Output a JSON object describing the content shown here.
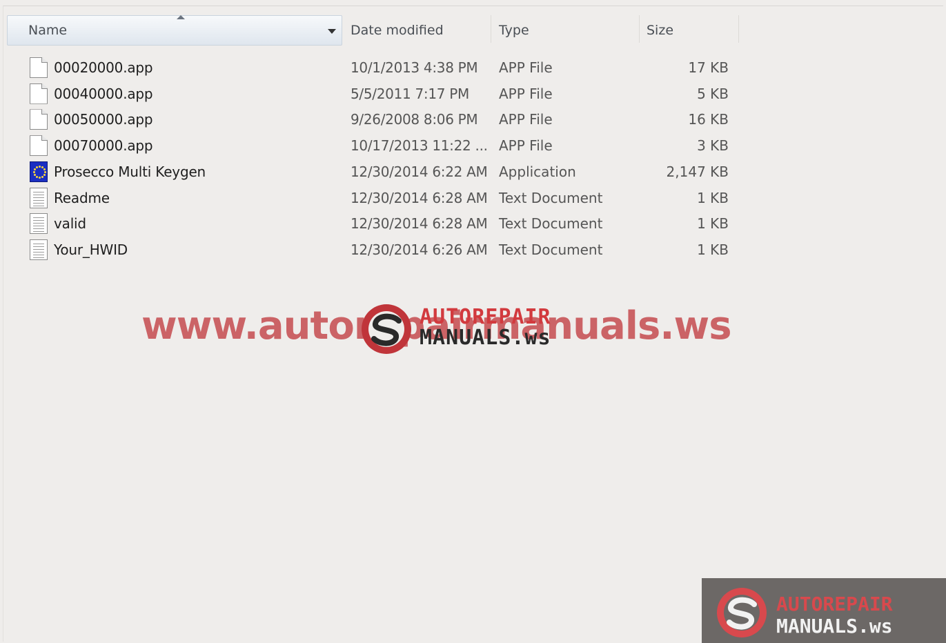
{
  "columns": {
    "name": "Name",
    "date": "Date modified",
    "type": "Type",
    "size": "Size"
  },
  "files": [
    {
      "name": "00020000.app",
      "date": "10/1/2013 4:38 PM",
      "type": "APP File",
      "size": "17 KB",
      "icon": "file-icon"
    },
    {
      "name": "00040000.app",
      "date": "5/5/2011 7:17 PM",
      "type": "APP File",
      "size": "5 KB",
      "icon": "file-icon"
    },
    {
      "name": "00050000.app",
      "date": "9/26/2008 8:06 PM",
      "type": "APP File",
      "size": "16 KB",
      "icon": "file-icon"
    },
    {
      "name": "00070000.app",
      "date": "10/17/2013 11:22 ...",
      "type": "APP File",
      "size": "3 KB",
      "icon": "file-icon"
    },
    {
      "name": "Prosecco Multi Keygen",
      "date": "12/30/2014 6:22 AM",
      "type": "Application",
      "size": "2,147 KB",
      "icon": "application-icon"
    },
    {
      "name": "Readme",
      "date": "12/30/2014 6:28 AM",
      "type": "Text Document",
      "size": "1 KB",
      "icon": "text-document-icon"
    },
    {
      "name": "valid",
      "date": "12/30/2014 6:28 AM",
      "type": "Text Document",
      "size": "1 KB",
      "icon": "text-document-icon"
    },
    {
      "name": "Your_HWID",
      "date": "12/30/2014 6:26 AM",
      "type": "Text Document",
      "size": "1 KB",
      "icon": "text-document-icon"
    }
  ],
  "watermark": {
    "url_text": "www.autorepairmanuals.ws",
    "brand_line1": "AUTOREPAIR",
    "brand_line2": "MANUALS.ws"
  },
  "corner_badge": {
    "line1": "AUTOREPAIR",
    "line2": "MANUALS.ws"
  },
  "colors": {
    "background": "#efedeb",
    "watermark_red": "#c0353a",
    "header_gradient_top": "#f7f9fb",
    "header_gradient_bottom": "#dfe6ee"
  }
}
